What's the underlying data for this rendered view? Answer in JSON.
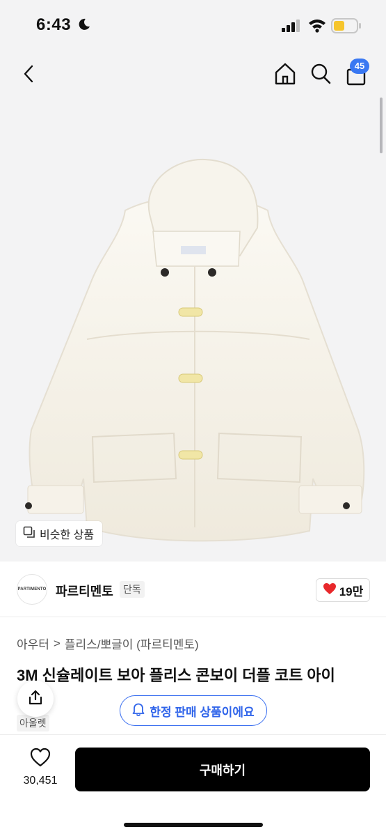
{
  "status_bar": {
    "time": "6:43",
    "icons": [
      "moon-icon",
      "signal-icon",
      "wifi-icon",
      "battery-icon"
    ]
  },
  "nav": {
    "icons": [
      "back-icon",
      "home-icon",
      "search-icon",
      "cart-icon"
    ],
    "cart_badge": "45"
  },
  "image": {
    "similar_label": "비슷한 상품"
  },
  "shop": {
    "logo_text": "PARTIMENTO",
    "name": "파르티멘토",
    "tag": "단독",
    "like_count": "19만"
  },
  "breadcrumb": {
    "category": "아우터",
    "separator": ">",
    "subcategory": "플리스/뽀글이 (파르티멘토)"
  },
  "product": {
    "title": "3M 신슐레이트 보아 플리스 콘보이 더플 코트 아이",
    "sub_tag": "아울렛"
  },
  "limited_notice": "한정 판매 상품이에요",
  "bottom": {
    "wish_count": "30,451",
    "buy_label": "구매하기"
  },
  "colors": {
    "accent_blue": "#3a78f2",
    "heart_red": "#e8282b",
    "buy_button": "#000000",
    "image_bg": "#f3f3f4"
  }
}
